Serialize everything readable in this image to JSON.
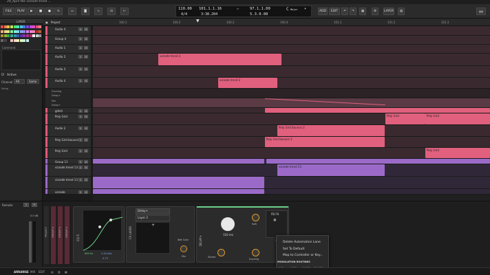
{
  "window": {
    "title": "29_April the vizrode trend ..."
  },
  "toolbar": {
    "file": "FILE",
    "play": "PLAY",
    "right_buttons": [
      "ADD",
      "EDIT"
    ],
    "layer": "LAYER"
  },
  "transport": {
    "tempo": "110.00",
    "signature": "4/4",
    "position": "101.1.1.16",
    "time": "3:38.204",
    "loop_start": "97.1.1.00",
    "loop_length": "5.3.0.00",
    "key": "C",
    "key_sub": "Major"
  },
  "sidebar": {
    "header": "LAYER",
    "comment_label": "Comment",
    "active_label": "Active",
    "channel_label": "Channel",
    "channel_value": "All",
    "same_value": "Same",
    "section_label": "Setup",
    "palette": [
      "#e84a4a",
      "#e8804a",
      "#e8c24a",
      "#c2e84a",
      "#4ae86c",
      "#4ae8c2",
      "#4ac2e8",
      "#4a80e8",
      "#7a4ae8",
      "#c24ae8",
      "#e84ac2",
      "#e84a80",
      "#f08080",
      "#f0a880",
      "#f0d880",
      "#d8f080",
      "#80f0a0",
      "#80f0d8",
      "#80d8f0",
      "#80a8f0",
      "#a080f0",
      "#d880f0",
      "#f080d8",
      "#f080a8",
      "#b03030",
      "#b06030",
      "#b09030",
      "#90b030",
      "#30b050",
      "#30b090",
      "#3090b0",
      "#3060b0",
      "#5030b0",
      "#9030b0",
      "#b03090",
      "#b03060",
      "#ffffff",
      "#cccccc",
      "#999999",
      "#666666",
      "#444444",
      "#222222",
      "#f6c2c2",
      "#f6dac2",
      "#f6eec2",
      "#e6f6c2",
      "#c2f6d0",
      "#c2f0f6"
    ]
  },
  "project_label": "Project",
  "ruler_marks": [
    "100.1",
    "100.2",
    "100.3",
    "100.4",
    "101.1",
    "101.2",
    "101.3"
  ],
  "tracks": [
    {
      "name": "Audio 4",
      "color": "#e05a7a"
    },
    {
      "name": "Group 4",
      "color": "#e05a7a"
    },
    {
      "name": "Audio 1",
      "color": "#e05a7a"
    },
    {
      "name": "Audio 2",
      "color": "#e05a7a"
    },
    {
      "name": "Audio 3",
      "color": "#e05a7a"
    },
    {
      "name": "Audio 4",
      "color": "#e05a7a"
    },
    {
      "name": "glitch",
      "color": "#e05a7a"
    },
    {
      "name": "Poly Grid",
      "color": "#e05a7a"
    },
    {
      "name": "Audio 2",
      "color": "#e05a7a"
    },
    {
      "name": "Poly Grid bounce 2",
      "color": "#e05a7a"
    },
    {
      "name": "Poly Grid",
      "color": "#e05a7a"
    },
    {
      "name": "Group 11",
      "color": "#9b6ac9"
    },
    {
      "name": "vizrode trend 13",
      "color": "#9b6ac9"
    },
    {
      "name": "vizrode trend 13",
      "color": "#9b6ac9"
    },
    {
      "name": "vizrode",
      "color": "#9b6ac9"
    }
  ],
  "automation": {
    "param1": "Ducking",
    "param2": "Delay+",
    "param3": "Mix",
    "param4": "Delay+"
  },
  "clips": {
    "a": "vizrode trend 3",
    "b": "vizrode trend 2",
    "c": "Poly Grid bounce 2",
    "d": "Poly Grid bounce 2",
    "e": "Poly Grid",
    "f": "Poly Grid",
    "g": "Poly Grid",
    "h": "vizrode trend 13"
  },
  "devices": {
    "mixer_label": "Remote",
    "fader_value": "0.0 dB",
    "channels": [
      "PROJECT",
      "GROUP 4",
      "GROUP 4",
      "GROUP 4"
    ],
    "eq_title": "EQ-5",
    "eq_values": [
      "699 Hz",
      "2.40 kHz",
      "0.75"
    ],
    "fxlayer_title": "FX LAYER",
    "layers": [
      "Delay+",
      "Layer 2"
    ],
    "wet_gain": "Wet Gain",
    "mix": "Mix",
    "delay_title": "DELAY+",
    "delay_time": "116 ms",
    "soft": "Soft",
    "stereo": "Stereo",
    "ducking": "Ducking",
    "fbfx": "FB FX",
    "max": "MAX"
  },
  "context_menu": {
    "items": [
      "Delete Automation Lane",
      "Set To Default",
      "Map to Controller or Key..."
    ],
    "section": "MODULATION ROUTINES",
    "actions": [
      "CUT",
      "COPY",
      "PASTE",
      "DELETE"
    ]
  },
  "status": {
    "arrange": "ARRANGE",
    "mix": "MIX",
    "edit": "EDIT"
  }
}
